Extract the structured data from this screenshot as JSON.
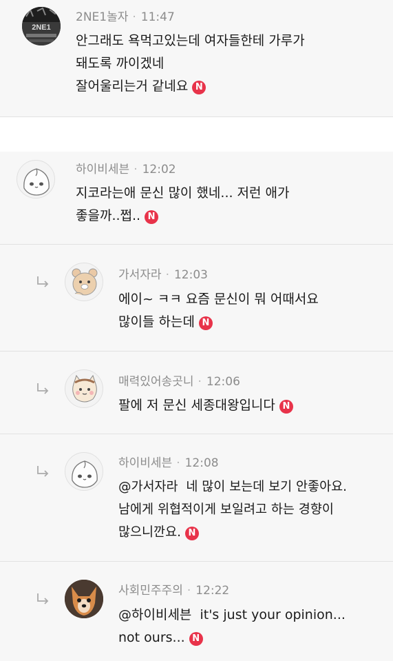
{
  "badge_letter": "N",
  "comments": [
    {
      "nickname": "2NE1놀자",
      "time": "11:47",
      "lines": [
        "안그래도 욕먹고있는데 여자들한테 가루가",
        "돼도록 까이겠네",
        "잘어울리는거 같네요"
      ],
      "avatar": "group-photo-icon",
      "avatar_text": "2NE1",
      "is_reply": false
    },
    {
      "nickname": "하이비세븐",
      "time": "12:02",
      "lines": [
        "지코라는애 문신 많이 했네... 저런 애가",
        "좋을까..쩝.."
      ],
      "avatar": "apeach-character-icon",
      "is_reply": false
    },
    {
      "nickname": "가서자라",
      "time": "12:03",
      "lines": [
        "에이~ ㅋㅋ 요즘 문신이 뭐 어때서요",
        "많이들 하는데"
      ],
      "avatar": "bear-character-icon",
      "is_reply": true
    },
    {
      "nickname": "매력있어송곳니",
      "time": "12:06",
      "lines": [
        "팔에 저 문신 세종대왕입니다"
      ],
      "avatar": "cat-character-icon",
      "is_reply": true
    },
    {
      "nickname": "하이비세븐",
      "time": "12:08",
      "mention": "@가서자라",
      "lines": [
        "  네 많이 보는데 보기 안좋아요.",
        "남에게 위협적이게 보일려고 하는 경향이",
        "많으니깐요."
      ],
      "avatar": "apeach-character-icon",
      "is_reply": true
    },
    {
      "nickname": "사회민주주의",
      "time": "12:22",
      "mention": "@하이비세븐",
      "lines": [
        "  it's just your opinion...",
        "not ours..."
      ],
      "avatar": "dog-photo-icon",
      "is_reply": true
    }
  ],
  "colors": {
    "badge": "#e8334a",
    "meta": "#8c8c8c",
    "row_bg": "#f7f7f7"
  }
}
